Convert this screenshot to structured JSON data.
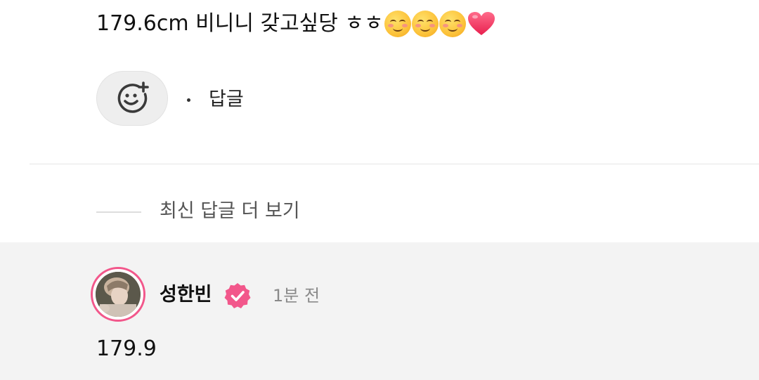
{
  "comment": {
    "text": "179.6cm 비니니 갖고싶당 ㅎㅎ",
    "emojis": [
      "smiling-face-icon",
      "smiling-face-icon",
      "smiling-face-icon",
      "heart-icon"
    ]
  },
  "actions": {
    "add_reaction_icon": "add-emoji-icon",
    "reply_label": "답글"
  },
  "replies": {
    "more_label": "최신 답글 더 보기"
  },
  "reply": {
    "author": "성한빈",
    "verified_icon": "verified-badge-icon",
    "time": "1분 전",
    "text": "179.9"
  },
  "colors": {
    "accent": "#f2578b",
    "reply_bg": "#f3f3f3",
    "muted": "#8a8a8a"
  }
}
